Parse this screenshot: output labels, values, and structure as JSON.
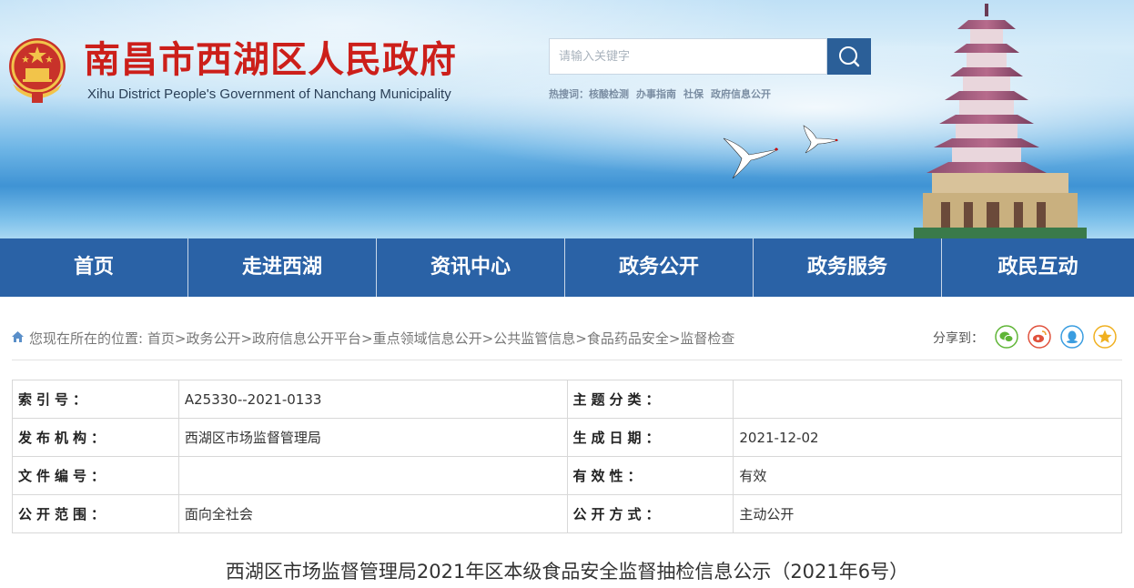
{
  "header": {
    "site_title": "南昌市西湖区人民政府",
    "site_subtitle": "Xihu District People's Government of Nanchang Municipality",
    "search_placeholder": "请输入关键字",
    "hot_label": "热搜词：",
    "hot_words": [
      "核酸检测",
      "办事指南",
      "社保",
      "政府信息公开"
    ]
  },
  "nav": {
    "items": [
      "首页",
      "走进西湖",
      "资讯中心",
      "政务公开",
      "政务服务",
      "政民互动"
    ]
  },
  "breadcrumb": {
    "prefix": "您现在所在的位置:",
    "items": [
      "首页",
      "政务公开",
      "政府信息公开平台",
      "重点领域信息公开",
      "公共监管信息",
      "食品药品安全",
      "监督检查"
    ],
    "separator": ">"
  },
  "share": {
    "label": "分享到：",
    "icons": [
      "wechat-icon",
      "weibo-icon",
      "qq-icon",
      "qzone-icon"
    ]
  },
  "meta": {
    "rows": [
      {
        "k1": "索引号：",
        "v1": "A25330--2021-0133",
        "k2": "主题分类：",
        "v2": ""
      },
      {
        "k1": "发布机构：",
        "v1": "西湖区市场监督管理局",
        "k2": "生成日期：",
        "v2": "2021-12-02"
      },
      {
        "k1": "文件编号：",
        "v1": "",
        "k2": "有效性：",
        "v2": "有效"
      },
      {
        "k1": "公开范围：",
        "v1": "面向全社会",
        "k2": "公开方式：",
        "v2": "主动公开"
      }
    ]
  },
  "document": {
    "title": "西湖区市场监督管理局2021年区本级食品安全监督抽检信息公示（2021年6号）"
  },
  "colors": {
    "nav_bg": "#2a62a6",
    "title_red": "#cc1f1a",
    "search_btn": "#2b5f98"
  }
}
